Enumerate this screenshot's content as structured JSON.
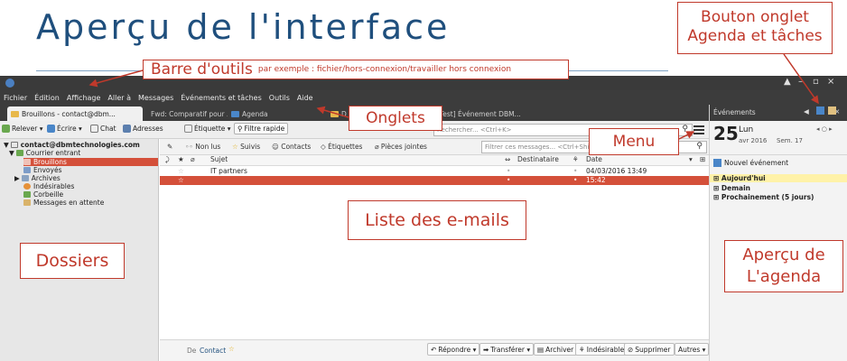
{
  "slide": {
    "title": "Aperçu de l'interface"
  },
  "callouts": {
    "toolbar_prefix": "Barre d'outils",
    "toolbar_suffix": "par exemple : fichier/hors-connexion/travailler hors connexion",
    "tabs": "Onglets",
    "menu": "Menu",
    "tasks_button_line1": "Bouton onglet",
    "tasks_button_line2": "Agenda et tâches",
    "email_list": "Liste des e-mails",
    "folders": "Dossiers",
    "agenda_line1": "Aperçu de",
    "agenda_line2": "L'agenda"
  },
  "window": {
    "controls": [
      "▲",
      "–",
      "▫",
      "×"
    ]
  },
  "menubar": {
    "items": [
      "Fichier",
      "Édition",
      "Affichage",
      "Aller à",
      "Messages",
      "Événements et tâches",
      "Outils",
      "Aide"
    ]
  },
  "tabs": [
    {
      "label": "Brouillons - contact@dbm..."
    },
    {
      "label": "Fwd: Comparatif pour ..."
    },
    {
      "label": "Agenda"
    },
    {
      "label": "D"
    },
    {
      "label": "[Test] Événement DBM..."
    }
  ],
  "toolbar": {
    "relever": "Relever",
    "ecrire": "Écrire",
    "chat": "Chat",
    "adresses": "Adresses",
    "etiquette": "Étiquette",
    "filtre_rapide": "Filtre rapide",
    "search_placeholder": "Rechercher... <Ctrl+K>"
  },
  "folders": {
    "account": "contact@dbmtechnologies.com",
    "items": [
      "Courrier entrant",
      "Brouillons",
      "Envoyés",
      "Archives",
      "Indésirables",
      "Corbeille",
      "Messages en attente"
    ]
  },
  "filterbar": {
    "non_lus": "Non lus",
    "suivis": "Suivis",
    "contacts": "Contacts",
    "etiquettes": "Étiquettes",
    "pieces_jointes": "Pièces jointes",
    "filter_placeholder": "Filtrer ces messages... <Ctrl+Shift+K>"
  },
  "columns": {
    "sujet": "Sujet",
    "destinataire": "Destinataire",
    "date": "Date"
  },
  "messages": [
    {
      "subject": "IT partners",
      "recipient": "",
      "date": "04/03/2016 13:49"
    },
    {
      "subject": "",
      "recipient": "",
      "date": "15:42"
    }
  ],
  "preview": {
    "de": "De",
    "contact": "Contact",
    "repondre": "Répondre",
    "transferer": "Transférer",
    "archiver": "Archiver",
    "indesirable": "Indésirable",
    "supprimer": "Supprimer",
    "autres": "Autres"
  },
  "agenda": {
    "header": "Événements",
    "day_number": "25",
    "day_name": "Lun",
    "month_year": "avr 2016",
    "week": "Sem. 17",
    "new_event": "Nouvel événement",
    "sections": [
      "Aujourd'hui",
      "Demain",
      "Prochainement (5 jours)"
    ]
  },
  "colors": {
    "title": "#1f4f7d",
    "callout": "#c0392b",
    "selection": "#d4503a",
    "today": "#fff2a8"
  }
}
